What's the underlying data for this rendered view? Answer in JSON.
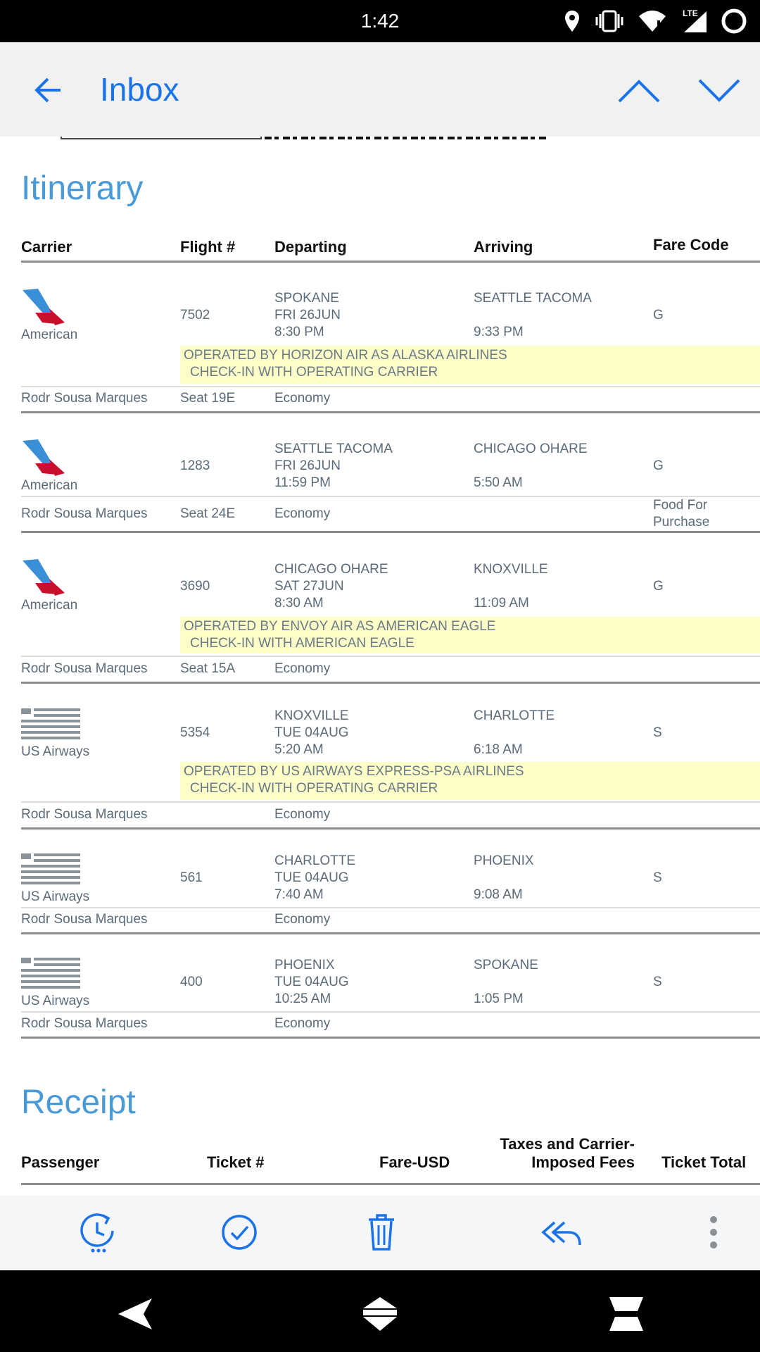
{
  "status_bar": {
    "time": "1:42",
    "network": "LTE"
  },
  "app_bar": {
    "title": "Inbox"
  },
  "itinerary": {
    "title": "Itinerary",
    "headers": {
      "carrier": "Carrier",
      "flight": "Flight #",
      "departing": "Departing",
      "arriving": "Arriving",
      "fare": "Fare Code"
    },
    "flights": [
      {
        "carrier": "American",
        "logo": "american-airlines-logo",
        "flight": "7502",
        "dep_city": "SPOKANE",
        "dep_date": "FRI 26JUN",
        "dep_time": "8:30 PM",
        "arr_city": "SEATTLE TACOMA",
        "arr_time": "9:33 PM",
        "fare": "G",
        "notice1": "OPERATED BY HORIZON AIR AS ALASKA AIRLINES",
        "notice2": "CHECK-IN WITH OPERATING CARRIER",
        "passenger": "Rodr Sousa Marques",
        "seat": "Seat 19E",
        "cabin": "Economy",
        "extra": ""
      },
      {
        "carrier": "American",
        "logo": "american-airlines-logo",
        "flight": "1283",
        "dep_city": "SEATTLE TACOMA",
        "dep_date": "FRI 26JUN",
        "dep_time": "11:59 PM",
        "arr_city": "CHICAGO OHARE",
        "arr_time": "5:50 AM",
        "fare": "G",
        "notice1": "",
        "notice2": "",
        "passenger": "Rodr Sousa Marques",
        "seat": "Seat 24E",
        "cabin": "Economy",
        "extra1": "Food For",
        "extra2": "Purchase"
      },
      {
        "carrier": "American",
        "logo": "american-airlines-logo",
        "flight": "3690",
        "dep_city": "CHICAGO OHARE",
        "dep_date": "SAT 27JUN",
        "dep_time": "8:30 AM",
        "arr_city": "KNOXVILLE",
        "arr_time": "11:09 AM",
        "fare": "G",
        "notice1": "OPERATED BY ENVOY AIR AS AMERICAN EAGLE",
        "notice2": "CHECK-IN WITH AMERICAN EAGLE",
        "passenger": "Rodr Sousa Marques",
        "seat": "Seat 15A",
        "cabin": "Economy"
      },
      {
        "carrier": "US Airways",
        "logo": "us-airways-logo",
        "flight": "5354",
        "dep_city": "KNOXVILLE",
        "dep_date": "TUE 04AUG",
        "dep_time": "5:20 AM",
        "arr_city": "CHARLOTTE",
        "arr_time": "6:18 AM",
        "fare": "S",
        "notice1": "OPERATED BY US AIRWAYS EXPRESS-PSA AIRLINES",
        "notice2": "CHECK-IN WITH OPERATING CARRIER",
        "passenger": "Rodr Sousa Marques",
        "seat": "",
        "cabin": "Economy"
      },
      {
        "carrier": "US Airways",
        "logo": "us-airways-logo",
        "flight": "561",
        "dep_city": "CHARLOTTE",
        "dep_date": "TUE 04AUG",
        "dep_time": "7:40 AM",
        "arr_city": "PHOENIX",
        "arr_time": "9:08 AM",
        "fare": "S",
        "passenger": "Rodr Sousa Marques",
        "seat": "",
        "cabin": "Economy"
      },
      {
        "carrier": "US Airways",
        "logo": "us-airways-logo",
        "flight": "400",
        "dep_city": "PHOENIX",
        "dep_date": "TUE 04AUG",
        "dep_time": "10:25 AM",
        "arr_city": "SPOKANE",
        "arr_time": "1:05 PM",
        "fare": "S",
        "passenger": "Rodr Sousa Marques",
        "seat": "",
        "cabin": "Economy"
      }
    ]
  },
  "receipt": {
    "title": "Receipt",
    "headers": {
      "passenger": "Passenger",
      "ticket": "Ticket #",
      "fare": "Fare-USD",
      "taxes1": "Taxes and Carrier-",
      "taxes2": "Imposed Fees",
      "total": "Ticket Total"
    }
  },
  "actions": [
    "snooze-icon",
    "mark-done-icon",
    "delete-icon",
    "reply-all-icon",
    "more-options-icon"
  ],
  "colors": {
    "accent": "#1a73e8",
    "section_title": "#4a9ad8",
    "notice_bg": "#fdfdc8"
  }
}
